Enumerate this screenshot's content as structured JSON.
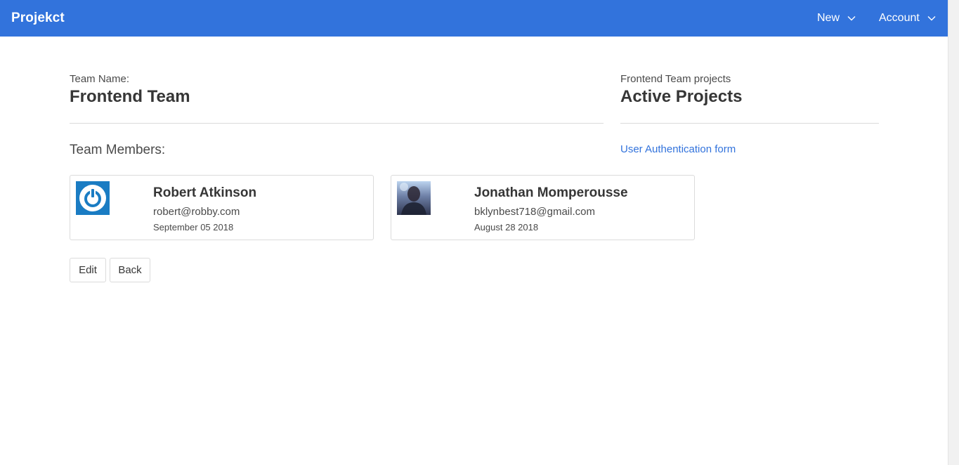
{
  "navbar": {
    "brand": "Projekct",
    "items": [
      {
        "label": "New",
        "icon": "chevron-down-icon"
      },
      {
        "label": "Account",
        "icon": "chevron-down-icon"
      }
    ],
    "color": "#3273dc"
  },
  "team": {
    "label": "Team Name:",
    "name": "Frontend Team",
    "members_heading": "Team Members:",
    "members": [
      {
        "name": "Robert Atkinson",
        "email": "robert@robby.com",
        "date": "September 05 2018",
        "avatar_icon": "power-icon"
      },
      {
        "name": "Jonathan Momperousse",
        "email": "bklynbest718@gmail.com",
        "date": "August 28 2018",
        "avatar_icon": "photo-avatar"
      }
    ]
  },
  "projects": {
    "label": "Frontend Team projects",
    "title": "Active Projects",
    "items": [
      {
        "label": "User Authentication form"
      }
    ]
  },
  "actions": {
    "edit_label": "Edit",
    "back_label": "Back"
  }
}
